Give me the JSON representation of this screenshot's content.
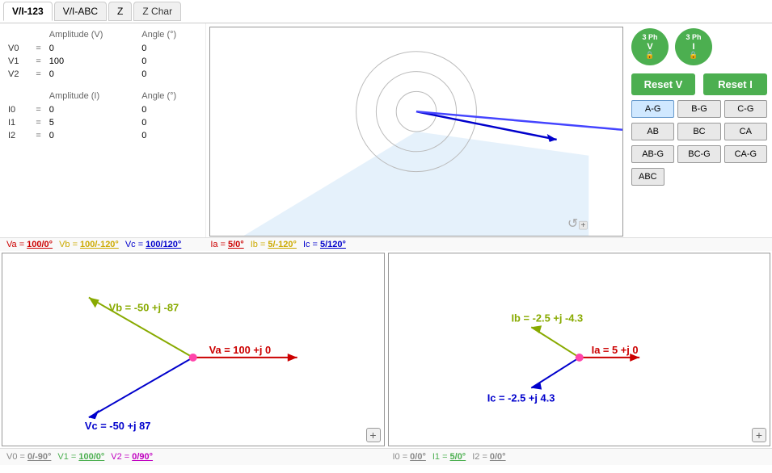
{
  "tabs": [
    {
      "id": "vi123",
      "label": "V/I-123",
      "active": true
    },
    {
      "id": "viabc",
      "label": "V/I-ABC",
      "active": false
    },
    {
      "id": "z",
      "label": "Z",
      "active": false
    },
    {
      "id": "zchar",
      "label": "Z Char",
      "active": false
    }
  ],
  "voltage_params": {
    "header_amplitude": "Amplitude (V)",
    "header_angle": "Angle (°)",
    "rows": [
      {
        "name": "V0",
        "eq": "=",
        "amplitude": "0",
        "angle": "0"
      },
      {
        "name": "V1",
        "eq": "=",
        "amplitude": "100",
        "angle": "0"
      },
      {
        "name": "V2",
        "eq": "=",
        "amplitude": "0",
        "angle": "0"
      }
    ]
  },
  "current_params": {
    "header_amplitude": "Amplitude (I)",
    "header_angle": "Angle (°)",
    "rows": [
      {
        "name": "I0",
        "eq": "=",
        "amplitude": "0",
        "angle": "0"
      },
      {
        "name": "I1",
        "eq": "=",
        "amplitude": "5",
        "angle": "0"
      },
      {
        "name": "I2",
        "eq": "=",
        "amplitude": "0",
        "angle": "0"
      }
    ]
  },
  "buttons": {
    "phase_v": "3 Ph\nV",
    "phase_i": "3 Ph\nI",
    "reset_v": "Reset V",
    "reset_i": "Reset I",
    "grid": [
      "A-G",
      "B-G",
      "C-G",
      "AB",
      "BC",
      "CA",
      "AB-G",
      "BC-G",
      "CA-G"
    ],
    "abc": "ABC",
    "selected_grid": "A-G"
  },
  "status_top": [
    {
      "label": "Va =",
      "value": "100/0°",
      "color": "va"
    },
    {
      "label": "Vb =",
      "value": "100/-120°",
      "color": "vb"
    },
    {
      "label": "Vc =",
      "value": "100/120°",
      "color": "vc"
    },
    {
      "label": "Ia =",
      "value": "5/0°",
      "color": "ia"
    },
    {
      "label": "Ib =",
      "value": "5/-120°",
      "color": "ib"
    },
    {
      "label": "Ic =",
      "value": "5/120°",
      "color": "ic"
    }
  ],
  "phasor_left": {
    "vectors": [
      {
        "label": "Va = 100 +j 0",
        "color": "#cc0000"
      },
      {
        "label": "Vb = -50 +j -87",
        "color": "#ccaa00"
      },
      {
        "label": "Vc = -50 +j 87",
        "color": "#0000cc"
      }
    ]
  },
  "phasor_right": {
    "vectors": [
      {
        "label": "Ia = 5 +j 0",
        "color": "#cc0000"
      },
      {
        "label": "Ib = -2.5 +j -4.3",
        "color": "#ccaa00"
      },
      {
        "label": "Ic = -2.5 +j 4.3",
        "color": "#0000cc"
      }
    ]
  },
  "status_bottom_left": [
    {
      "label": "V0 =",
      "value": "0/-90°",
      "color": "v0"
    },
    {
      "label": "V1 =",
      "value": "100/0°",
      "color": "v1"
    },
    {
      "label": "V2 =",
      "value": "0/90°",
      "color": "v2"
    }
  ],
  "status_bottom_right": [
    {
      "label": "I0 =",
      "value": "0/0°",
      "color": "i0"
    },
    {
      "label": "I1 =",
      "value": "5/0°",
      "color": "i1"
    },
    {
      "label": "I2 =",
      "value": "0/0°",
      "color": "i2"
    }
  ]
}
